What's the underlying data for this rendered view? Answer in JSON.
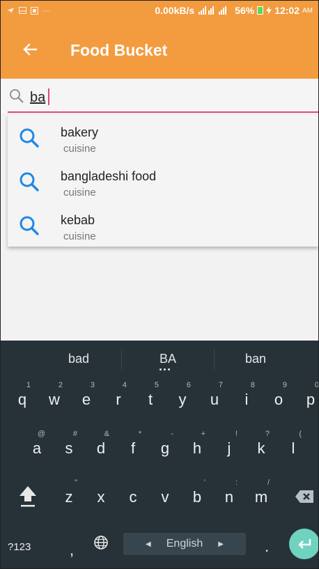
{
  "status_bar": {
    "speed": "0.00kB/s",
    "battery": "56%",
    "time": "12:02",
    "ampm": "AM"
  },
  "app_bar": {
    "title": "Food Bucket"
  },
  "search": {
    "query": "ba"
  },
  "suggestions": [
    {
      "title": "bakery",
      "subtitle": "cuisine"
    },
    {
      "title": "bangladeshi food",
      "subtitle": "cuisine"
    },
    {
      "title": "kebab",
      "subtitle": "cuisine"
    }
  ],
  "keyboard": {
    "word_suggestions": [
      "bad",
      "BA",
      "ban"
    ],
    "row1": [
      {
        "key": "q",
        "hint": "1"
      },
      {
        "key": "w",
        "hint": "2"
      },
      {
        "key": "e",
        "hint": "3"
      },
      {
        "key": "r",
        "hint": "4"
      },
      {
        "key": "t",
        "hint": "5"
      },
      {
        "key": "y",
        "hint": "6"
      },
      {
        "key": "u",
        "hint": "7"
      },
      {
        "key": "i",
        "hint": "8"
      },
      {
        "key": "o",
        "hint": "9"
      },
      {
        "key": "p",
        "hint": "0"
      }
    ],
    "row2": [
      {
        "key": "a",
        "hint": "@"
      },
      {
        "key": "s",
        "hint": "#"
      },
      {
        "key": "d",
        "hint": "&"
      },
      {
        "key": "f",
        "hint": "*"
      },
      {
        "key": "g",
        "hint": "-"
      },
      {
        "key": "h",
        "hint": "+"
      },
      {
        "key": "j",
        "hint": "!"
      },
      {
        "key": "k",
        "hint": "?"
      },
      {
        "key": "l",
        "hint": "("
      }
    ],
    "row3": [
      {
        "key": "z",
        "hint": "\""
      },
      {
        "key": "x",
        "hint": ""
      },
      {
        "key": "c",
        "hint": ""
      },
      {
        "key": "v",
        "hint": ""
      },
      {
        "key": "b",
        "hint": "'"
      },
      {
        "key": "n",
        "hint": ":"
      },
      {
        "key": "m",
        "hint": "/"
      }
    ],
    "symbols_label": "?123",
    "comma": ",",
    "period": ".",
    "language": "English"
  },
  "colors": {
    "accent": "#f39b3f",
    "underline": "#e0467c",
    "search_icon": "#1e88e5",
    "keyboard_bg": "#263238",
    "enter": "#6fd3c0"
  }
}
